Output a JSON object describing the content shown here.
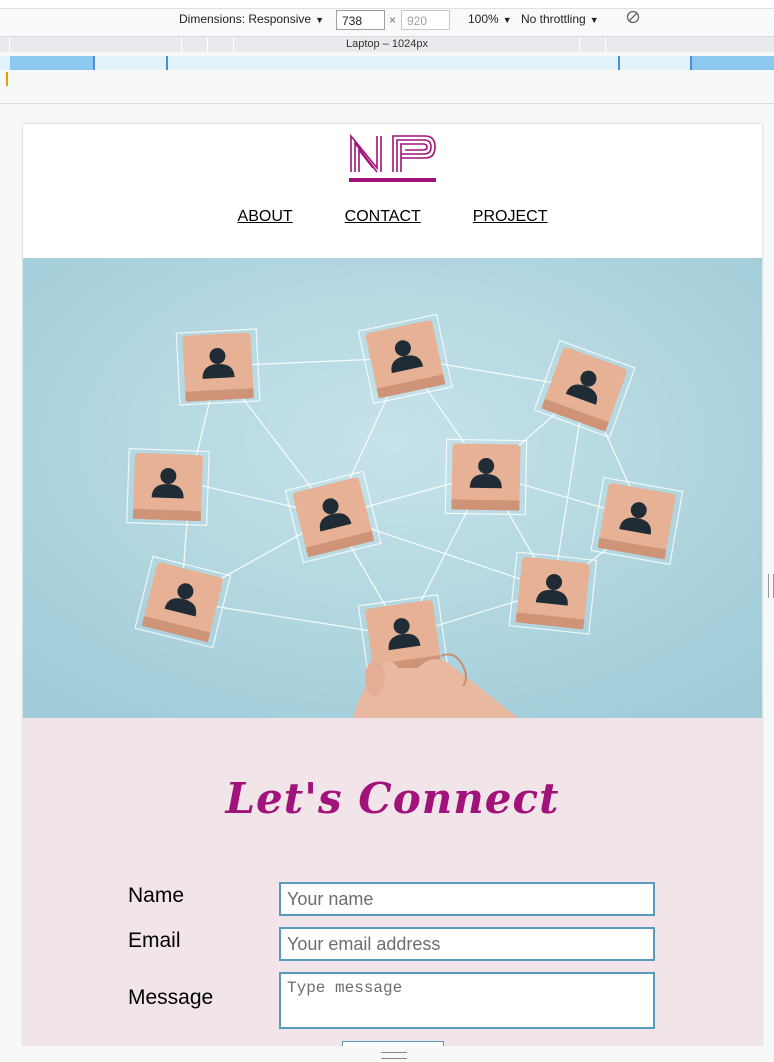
{
  "devtools": {
    "dimensions_label": "Dimensions: Responsive",
    "width_value": "738",
    "times": "×",
    "height_placeholder": "920",
    "zoom": "100%",
    "throttling": "No throttling",
    "media_query_label": "Laptop – 1024px"
  },
  "site": {
    "logo_text": "NP",
    "nav": [
      "ABOUT",
      "CONTACT",
      "PROJECT"
    ]
  },
  "contact": {
    "heading": "Let's Connect",
    "name_label": "Name",
    "name_placeholder": "Your name",
    "email_label": "Email",
    "email_placeholder": "Your email address",
    "message_label": "Message",
    "message_placeholder": "Type message"
  },
  "colors": {
    "accent": "#a1137a",
    "contact_bg": "#f1e5ea",
    "field_border": "#5a9bbd",
    "hero_bg": "#b8dde6"
  }
}
